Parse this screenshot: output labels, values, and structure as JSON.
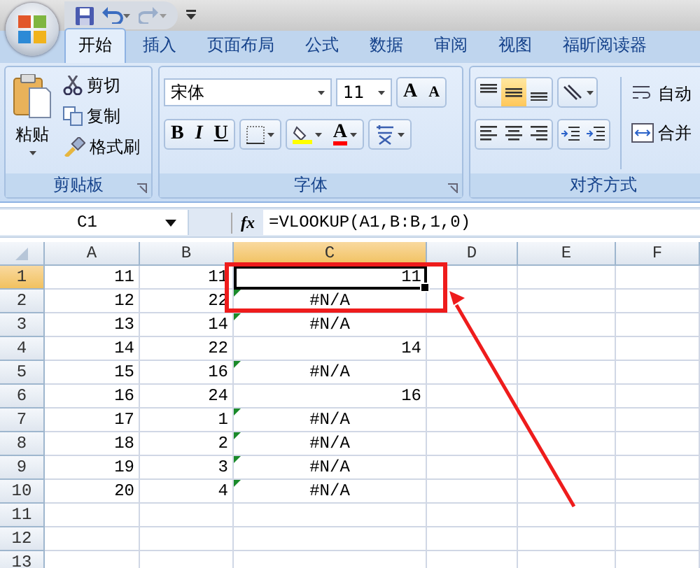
{
  "tabs": [
    {
      "label": "开始",
      "selected": true
    },
    {
      "label": "插入",
      "selected": false
    },
    {
      "label": "页面布局",
      "selected": false
    },
    {
      "label": "公式",
      "selected": false
    },
    {
      "label": "数据",
      "selected": false
    },
    {
      "label": "审阅",
      "selected": false
    },
    {
      "label": "视图",
      "selected": false
    },
    {
      "label": "福昕阅读器",
      "selected": false
    }
  ],
  "ribbon": {
    "clipboard": {
      "label": "剪贴板",
      "paste": "粘贴",
      "items": [
        "剪切",
        "复制",
        "格式刷"
      ]
    },
    "font": {
      "label": "字体",
      "font_name": "宋体",
      "font_size": "11",
      "grow_label": "A",
      "shrink_label": "A",
      "style_buttons": [
        "B",
        "I",
        "U"
      ],
      "color_label": "A"
    },
    "alignment": {
      "label": "对齐方式",
      "vertical": [
        {
          "selected": false
        },
        {
          "selected": true
        },
        {
          "selected": false
        }
      ],
      "wrap": "自动",
      "merge": "合并"
    }
  },
  "formula_bar": {
    "name_box": "C1",
    "function_label": "fx",
    "formula": "=VLOOKUP(A1,B:B,1,0)"
  },
  "columns": [
    {
      "label": "A",
      "selected": false
    },
    {
      "label": "B",
      "selected": false
    },
    {
      "label": "C",
      "selected": true
    },
    {
      "label": "D",
      "selected": false
    },
    {
      "label": "E",
      "selected": false
    },
    {
      "label": "F",
      "selected": false
    }
  ],
  "rows": [
    {
      "header": "1",
      "selected": true,
      "a": "11",
      "b": "11",
      "c": {
        "text": "11",
        "kind": "number"
      },
      "error_flag": false
    },
    {
      "header": "2",
      "selected": false,
      "a": "12",
      "b": "22",
      "c": {
        "text": "#N/A",
        "kind": "error"
      },
      "error_flag": true
    },
    {
      "header": "3",
      "selected": false,
      "a": "13",
      "b": "14",
      "c": {
        "text": "#N/A",
        "kind": "error"
      },
      "error_flag": true
    },
    {
      "header": "4",
      "selected": false,
      "a": "14",
      "b": "22",
      "c": {
        "text": "14",
        "kind": "number"
      },
      "error_flag": false
    },
    {
      "header": "5",
      "selected": false,
      "a": "15",
      "b": "16",
      "c": {
        "text": "#N/A",
        "kind": "error"
      },
      "error_flag": true
    },
    {
      "header": "6",
      "selected": false,
      "a": "16",
      "b": "24",
      "c": {
        "text": "16",
        "kind": "number"
      },
      "error_flag": false
    },
    {
      "header": "7",
      "selected": false,
      "a": "17",
      "b": "1",
      "c": {
        "text": "#N/A",
        "kind": "error"
      },
      "error_flag": true
    },
    {
      "header": "8",
      "selected": false,
      "a": "18",
      "b": "2",
      "c": {
        "text": "#N/A",
        "kind": "error"
      },
      "error_flag": true
    },
    {
      "header": "9",
      "selected": false,
      "a": "19",
      "b": "3",
      "c": {
        "text": "#N/A",
        "kind": "error"
      },
      "error_flag": true
    },
    {
      "header": "10",
      "selected": false,
      "a": "20",
      "b": "4",
      "c": {
        "text": "#N/A",
        "kind": "error"
      },
      "error_flag": true
    },
    {
      "header": "11",
      "selected": false,
      "error_flag": false
    },
    {
      "header": "12",
      "selected": false,
      "error_flag": false
    },
    {
      "header": "13",
      "selected": false,
      "error_flag": false
    }
  ]
}
